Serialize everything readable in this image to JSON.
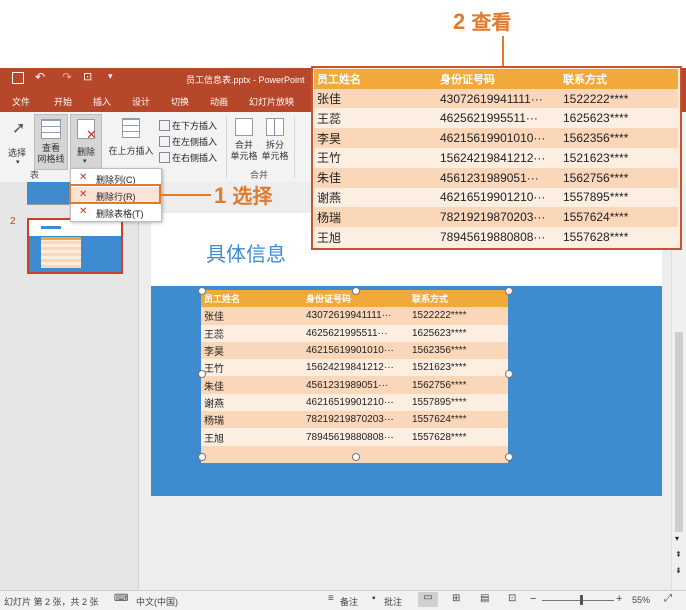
{
  "annotations": {
    "step2": {
      "num": "2",
      "text": "查看"
    },
    "step1": {
      "num": "1",
      "text": "选择"
    }
  },
  "titlebar": {
    "title": "员工信息表.pptx - PowerPoint"
  },
  "tabs": [
    "文件",
    "开始",
    "插入",
    "设计",
    "切换",
    "动画",
    "幻灯片放映"
  ],
  "ribbon": {
    "select_label": "选择",
    "gridlines_label": "查看\n网格线",
    "delete_label": "删除",
    "insert_above_label": "在上方插入",
    "insert_below": "在下方插入",
    "insert_left": "在左侧插入",
    "insert_right": "在右侧插入",
    "merge_label": "合并\n单元格",
    "split_label": "拆分\n单元格",
    "group_table": "表",
    "group_merge": "合并"
  },
  "dropdown": {
    "items": [
      "删除列(C)",
      "删除行(R)",
      "删除表格(T)"
    ]
  },
  "slide": {
    "number": "2",
    "title": "具体信息"
  },
  "table": {
    "headers": [
      "员工姓名",
      "身份证号码",
      "联系方式"
    ],
    "rows": [
      [
        "张佳",
        "43072619941111···",
        "1522222****"
      ],
      [
        "王蕊",
        "4625621995511···",
        "1625623****"
      ],
      [
        "李昊",
        "46215619901010···",
        "1562356****"
      ],
      [
        "王竹",
        "15624219841212···",
        "1521623****"
      ],
      [
        "朱佳",
        "4561231989051···",
        "1562756****"
      ],
      [
        "谢燕",
        "46216519901210···",
        "1557895****"
      ],
      [
        "杨瑞",
        "78219219870203···",
        "1557624****"
      ],
      [
        "王旭",
        "78945619880808···",
        "1557628****"
      ]
    ]
  },
  "statusbar": {
    "slide_info": "幻灯片 第 2 张，共 2 张",
    "language": "中文(中国)",
    "notes": "备注",
    "comments": "批注",
    "zoom": "55%"
  },
  "colors": {
    "accent": "#b7472a",
    "table_header": "#f2a93b",
    "annotation": "#e07a2c",
    "slide_blue": "#3f8bd0"
  }
}
